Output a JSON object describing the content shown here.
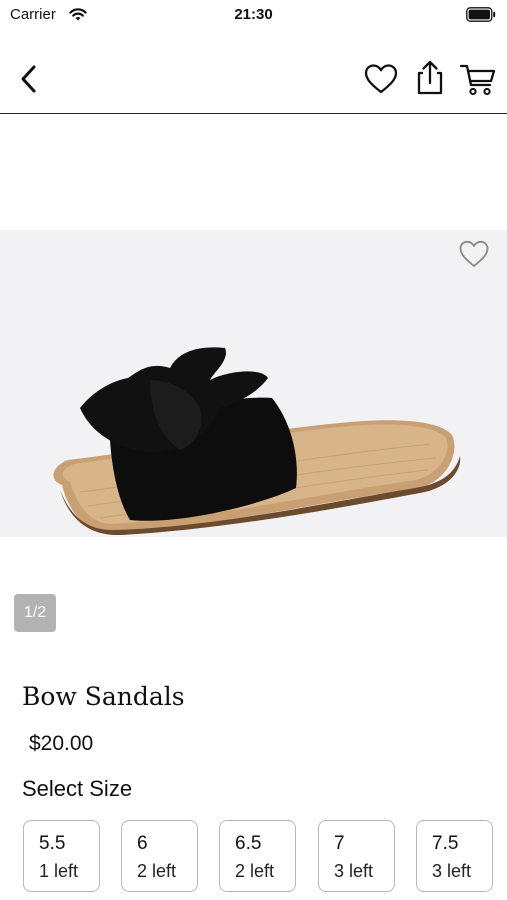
{
  "status_bar": {
    "carrier": "Carrier",
    "time": "21:30"
  },
  "nav": {
    "icons": [
      "chevron-left-icon",
      "heart-outline-icon",
      "share-icon",
      "cart-icon"
    ]
  },
  "gallery": {
    "page_indicator": "1/2",
    "image_subject": "black bow slide sandal on woven jute sole",
    "favorite_icon": "heart-outline-icon"
  },
  "product": {
    "title": "Bow Sandals",
    "price": "$20.00"
  },
  "sizes": {
    "heading": "Select Size",
    "options": [
      {
        "size": "5.5",
        "stock": "1 left"
      },
      {
        "size": "6",
        "stock": "2 left"
      },
      {
        "size": "6.5",
        "stock": "2 left"
      },
      {
        "size": "7",
        "stock": "3 left"
      },
      {
        "size": "7.5",
        "stock": "3 left"
      }
    ]
  },
  "colors": {
    "text": "#111111",
    "border": "#b8b8b8",
    "indicator": "#b3b3b3",
    "image_bg": "#f2f2f4"
  }
}
